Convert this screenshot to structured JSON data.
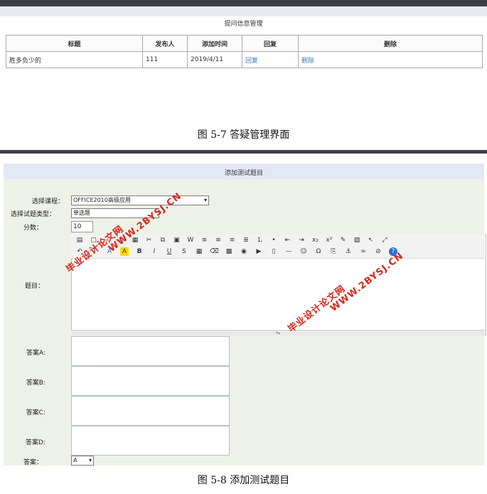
{
  "fig1": {
    "panel_title": "提问信息管理",
    "headers": [
      "标题",
      "发布人",
      "添加时间",
      "回复",
      "删除"
    ],
    "rows": [
      {
        "title": "胜多负少的",
        "publisher": "111",
        "time": "2019/4/11",
        "reply": "回复",
        "delete": "删除"
      }
    ],
    "caption": "图 5-7 答疑管理界面"
  },
  "fig2": {
    "panel_title": "添加测试题目",
    "course_label": "选择课程：",
    "course_value": "OFFICE2010高级应用",
    "type_label": "选择试题类型：",
    "type_value": "单选题",
    "score_label": "分数：",
    "score_value": "10",
    "question_label": "题目：",
    "answer_a_label": "答案A:",
    "answer_b_label": "答案B:",
    "answer_c_label": "答案C:",
    "answer_d_label": "答案D:",
    "answer_label": "答案：",
    "answer_value": "A",
    "caption": "图 5-8 添加测试题目"
  },
  "watermarks": {
    "site_cn": "毕业设计论文网",
    "site_url": "WWW.2BYSJ.CN"
  },
  "toolbar_icons_row1": [
    "source-icon",
    "new-page-icon",
    "preview-icon",
    "print-icon",
    "templates-icon",
    "cut-icon",
    "copy-icon",
    "paste-icon",
    "paste-word-icon",
    "align-left-icon",
    "align-center-icon",
    "align-right-icon",
    "justify-icon",
    "ordered-list-icon",
    "unordered-list-icon",
    "outdent-icon",
    "indent-icon",
    "subscript-icon",
    "superscript-icon",
    "format-icon",
    "select-all-icon",
    "pointer-icon",
    "maximize-icon"
  ],
  "toolbar_icons_row2": [
    "undo-icon",
    "font-size-icon",
    "font-color-icon",
    "bg-color-icon",
    "bold-icon",
    "italic-icon",
    "underline-icon",
    "strike-icon",
    "table-icon",
    "remove-format-icon",
    "image-icon",
    "flash-icon",
    "media-icon",
    "file-icon",
    "hr-icon",
    "emoticon-icon",
    "special-char-icon",
    "page-break-icon",
    "anchor-icon",
    "link-icon",
    "unlink-icon",
    "about-icon"
  ],
  "colors": {
    "dark_bar": "#3b3f47",
    "link": "#3c7dc4",
    "panel_bg": "#eef1e8",
    "panel_title_bg": "#e3e8f5",
    "watermark": "#d9261c"
  }
}
